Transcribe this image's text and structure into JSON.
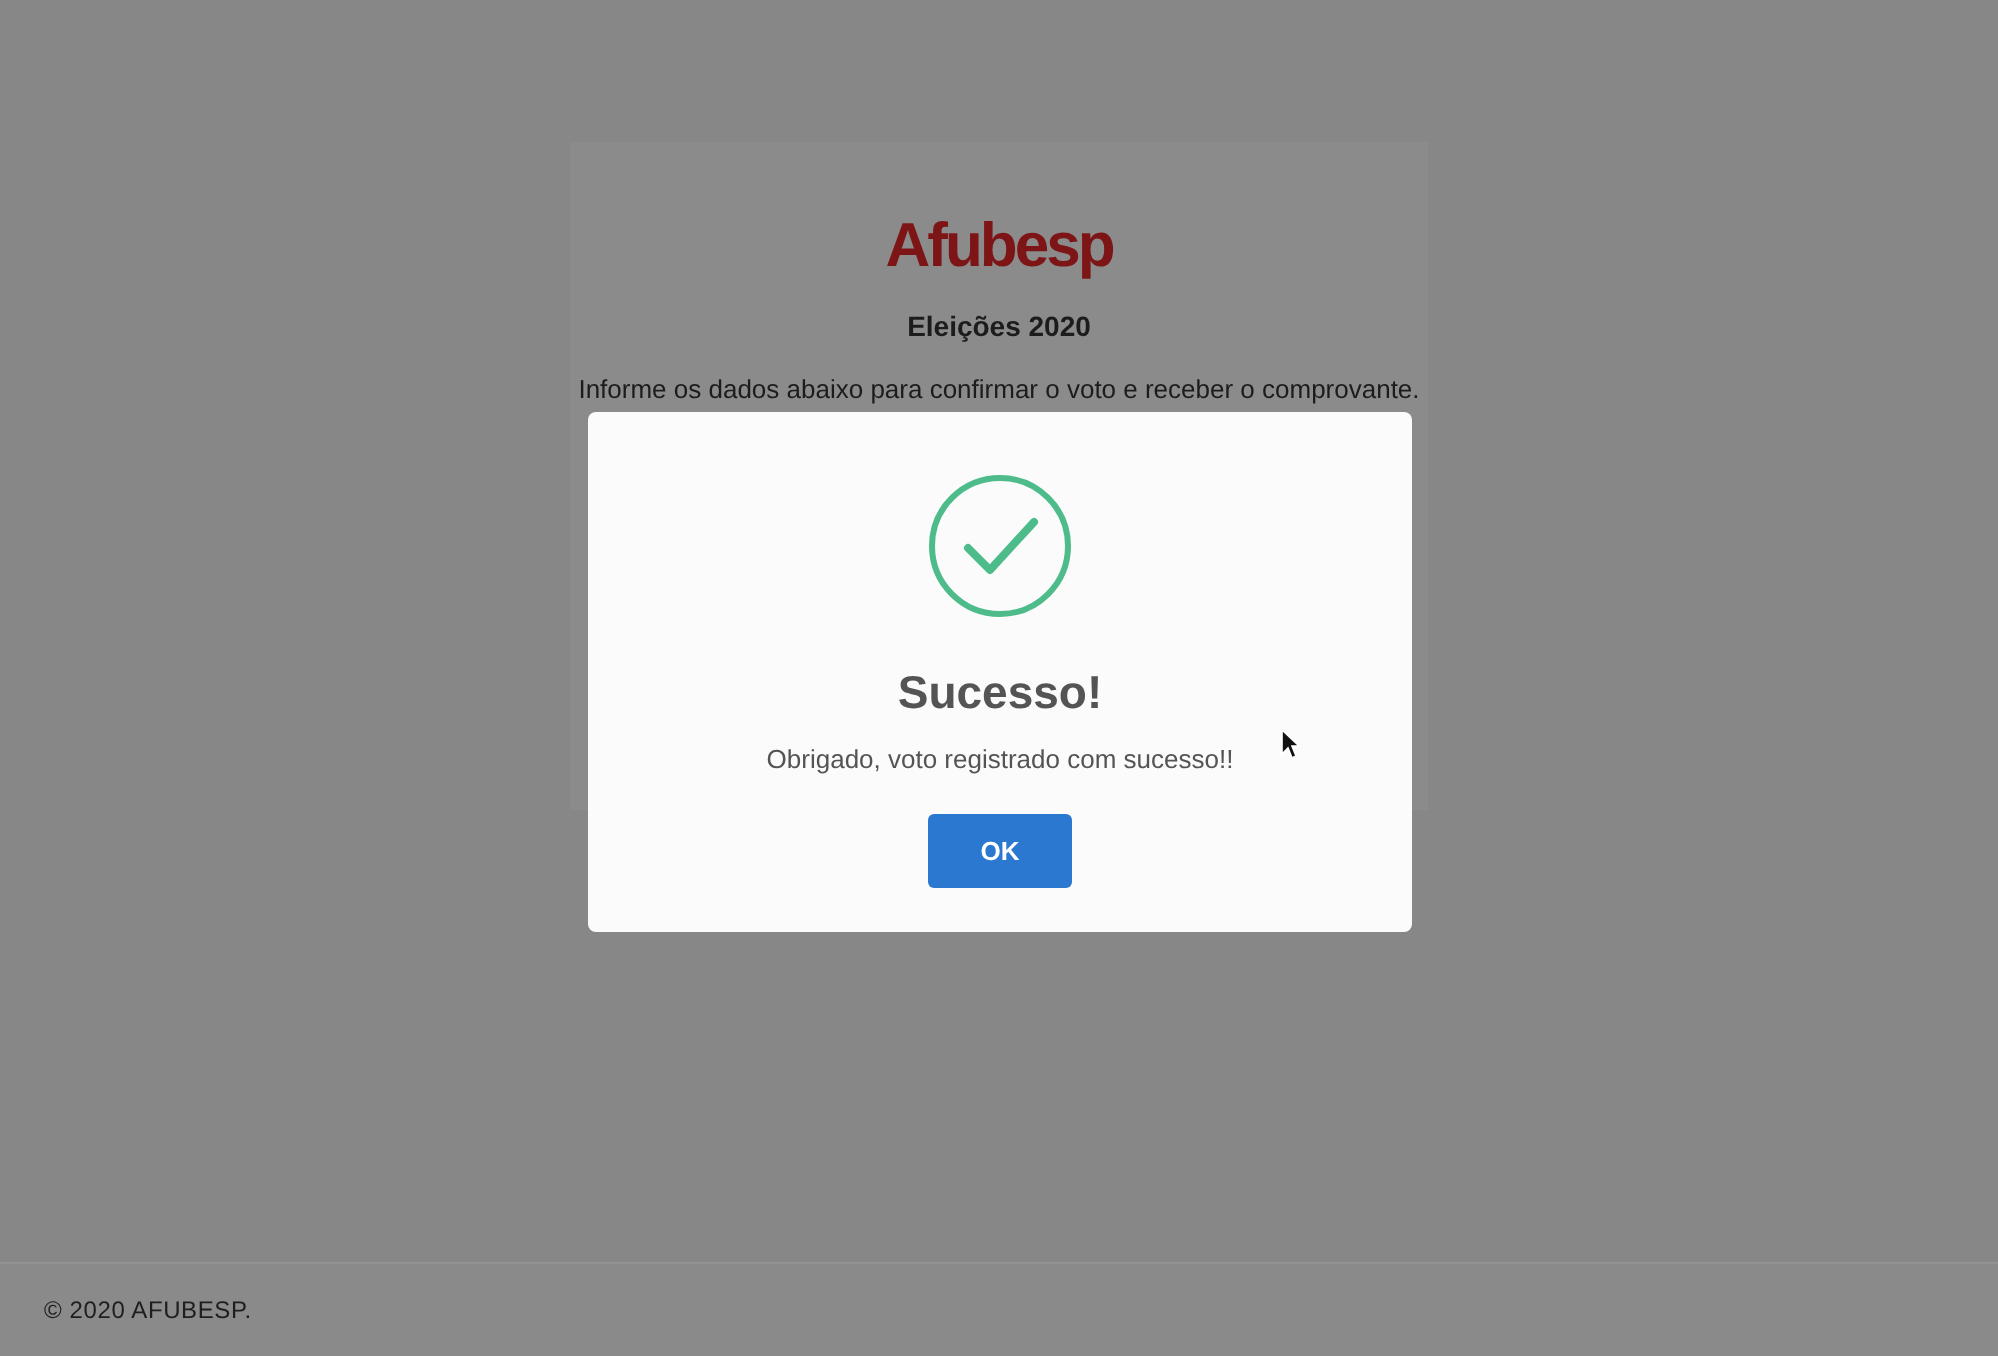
{
  "page": {
    "logo": "Afubesp",
    "title": "Eleições 2020",
    "instructions": "Informe os dados abaixo para confirmar o voto e receber o comprovante."
  },
  "dialog": {
    "title": "Sucesso!",
    "message": "Obrigado, voto registrado com sucesso!!",
    "buttons": [
      "OK"
    ]
  },
  "footer": {
    "text": "© 2020 AFUBESP."
  }
}
